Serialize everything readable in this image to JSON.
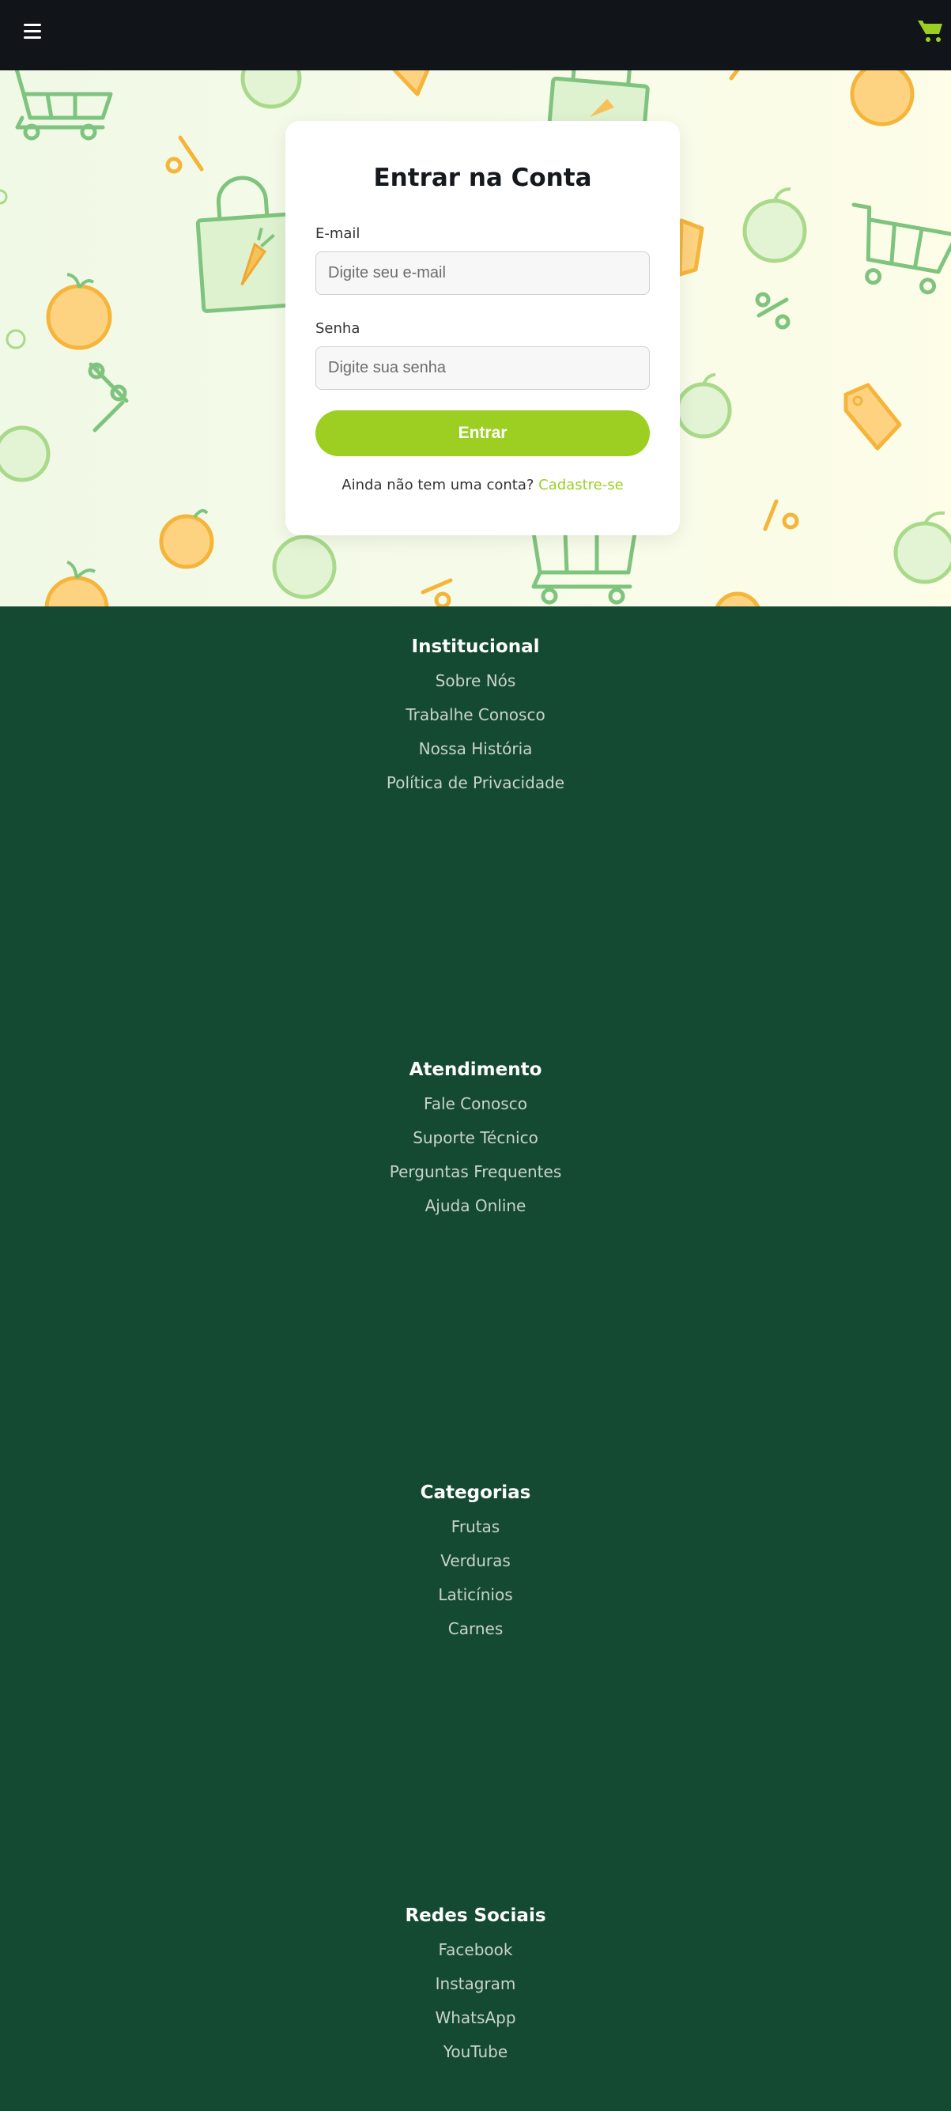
{
  "colors": {
    "topbar": "#111419",
    "accent": "#9ccf22",
    "footer": "#154a32",
    "footer_link": "#c9d3cd"
  },
  "icons": {
    "menu": "hamburger-icon",
    "cart": "shopping-cart-icon"
  },
  "login": {
    "title": "Entrar na Conta",
    "email_label": "E-mail",
    "email_placeholder": "Digite seu e-mail",
    "email_value": "",
    "password_label": "Senha",
    "password_placeholder": "Digite sua senha",
    "password_value": "",
    "submit_label": "Entrar",
    "signup_prompt": "Ainda não tem uma conta?",
    "signup_link": "Cadastre-se"
  },
  "footer": {
    "sections": [
      {
        "title": "Institucional",
        "links": [
          "Sobre Nós",
          "Trabalhe Conosco",
          "Nossa História",
          "Política de Privacidade"
        ]
      },
      {
        "title": "Atendimento",
        "links": [
          "Fale Conosco",
          "Suporte Técnico",
          "Perguntas Frequentes",
          "Ajuda Online"
        ]
      },
      {
        "title": "Categorias",
        "links": [
          "Frutas",
          "Verduras",
          "Laticínios",
          "Carnes"
        ]
      },
      {
        "title": "Redes Sociais",
        "links": [
          "Facebook",
          "Instagram",
          "WhatsApp",
          "YouTube"
        ]
      }
    ]
  }
}
